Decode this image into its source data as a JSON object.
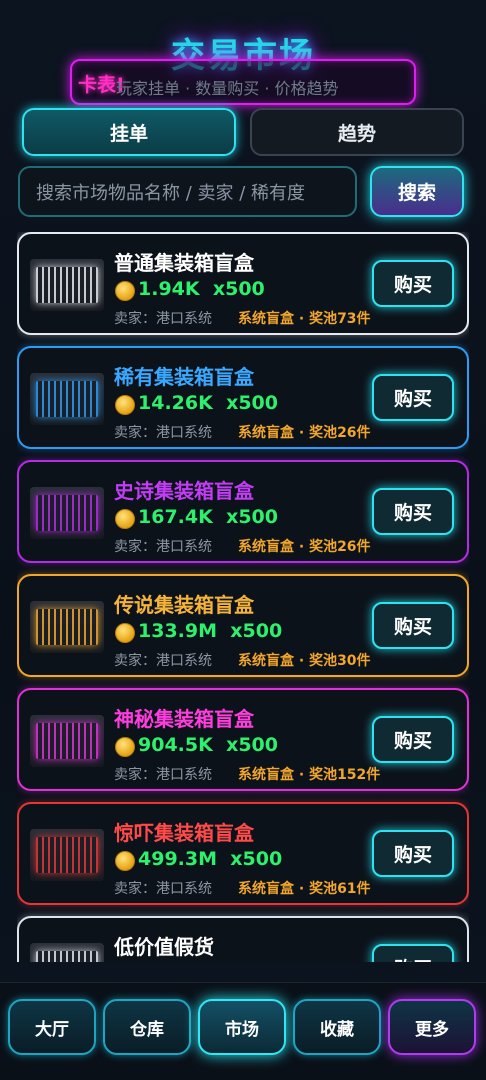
{
  "header": {
    "title": "交易市场",
    "banner_tag": "卡表!",
    "banner_text": "玩家挂单 · 数量购买 · 价格趋势"
  },
  "tabs": [
    {
      "label": "挂单",
      "active": true
    },
    {
      "label": "趋势",
      "active": false
    }
  ],
  "search": {
    "placeholder": "搜索市场物品名称 / 卖家 / 稀有度",
    "button_label": "搜索"
  },
  "items": [
    {
      "name": "普通集装箱盲盒",
      "price": "1.94K",
      "qty": "x500",
      "seller": "卖家：港口系统",
      "pool": "系统盲盒 · 奖池73件",
      "buy_label": "购买",
      "color": "#e6e9ee",
      "name_color": "#ffffff"
    },
    {
      "name": "稀有集装箱盲盒",
      "price": "14.26K",
      "qty": "x500",
      "seller": "卖家：港口系统",
      "pool": "系统盲盒 · 奖池26件",
      "buy_label": "购买",
      "color": "#2c9cf5",
      "name_color": "#3aa8ff"
    },
    {
      "name": "史诗集装箱盲盒",
      "price": "167.4K",
      "qty": "x500",
      "seller": "卖家：港口系统",
      "pool": "系统盲盒 · 奖池26件",
      "buy_label": "购买",
      "color": "#b52be8",
      "name_color": "#c33cf5"
    },
    {
      "name": "传说集装箱盲盒",
      "price": "133.9M",
      "qty": "x500",
      "seller": "卖家：港口系统",
      "pool": "系统盲盒 · 奖池30件",
      "buy_label": "购买",
      "color": "#f2a62b",
      "name_color": "#f5b33a"
    },
    {
      "name": "神秘集装箱盲盒",
      "price": "904.5K",
      "qty": "x500",
      "seller": "卖家：港口系统",
      "pool": "系统盲盒 · 奖池152件",
      "buy_label": "购买",
      "color": "#e22fd8",
      "name_color": "#ff3ddf"
    },
    {
      "name": "惊吓集装箱盲盒",
      "price": "499.3M",
      "qty": "x500",
      "seller": "卖家：港口系统",
      "pool": "系统盲盒 · 奖池61件",
      "buy_label": "购买",
      "color": "#e53535",
      "name_color": "#ff4a4a"
    },
    {
      "name": "低价值假货",
      "price": "",
      "qty": "",
      "seller": "",
      "pool": "",
      "buy_label": "购买",
      "color": "#dfe3ea",
      "name_color": "#ffffff"
    }
  ],
  "nav": [
    {
      "label": "大厅"
    },
    {
      "label": "仓库"
    },
    {
      "label": "市场",
      "active": true
    },
    {
      "label": "收藏"
    },
    {
      "label": "更多"
    }
  ]
}
